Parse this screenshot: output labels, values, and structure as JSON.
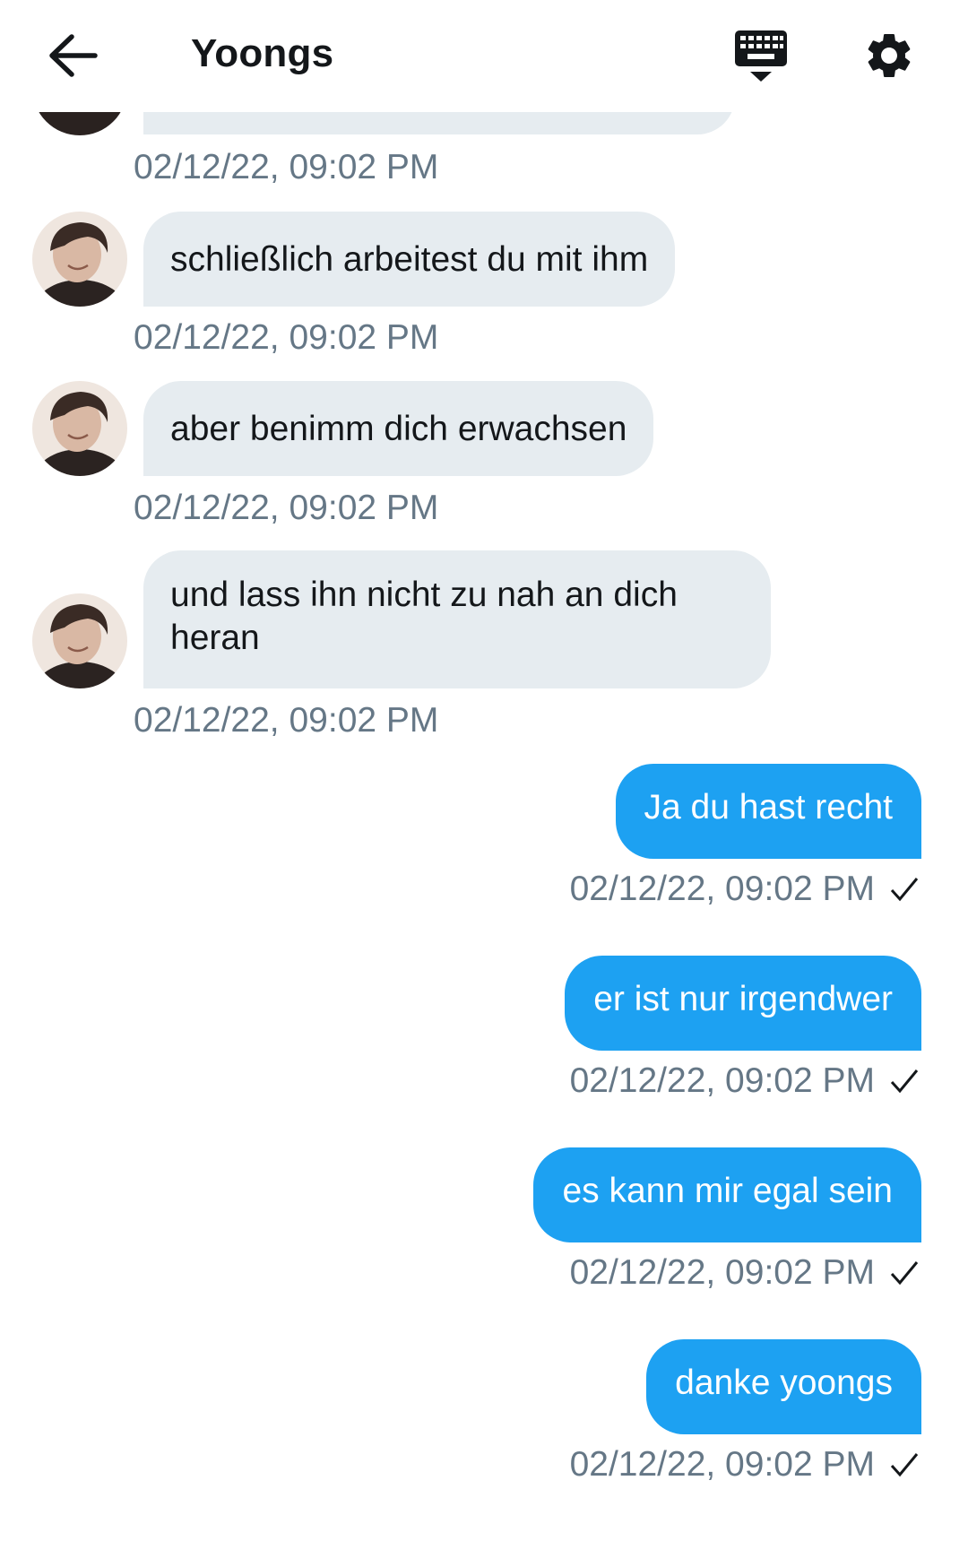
{
  "header": {
    "title": "Yoongs",
    "back_icon": "arrow-left-icon",
    "keyboard_icon": "keyboard-hide-icon",
    "settings_icon": "gear-icon"
  },
  "colors": {
    "incoming_bubble": "#e6ecf0",
    "outgoing_bubble": "#1da1f2",
    "timestamp": "#657786"
  },
  "messages": [
    {
      "direction": "in",
      "text": "schließlich arbeitest du mit ihm",
      "time": "02/12/22, 09:02 PM"
    },
    {
      "direction": "in",
      "text": "aber benimm dich erwachsen",
      "time": "02/12/22, 09:02 PM"
    },
    {
      "direction": "in",
      "text": "und lass ihn nicht zu nah an dich heran",
      "time": "02/12/22, 09:02 PM"
    },
    {
      "direction": "out",
      "text": "Ja du hast recht",
      "time": "02/12/22, 09:02 PM"
    },
    {
      "direction": "out",
      "text": "er ist nur irgendwer",
      "time": "02/12/22, 09:02 PM"
    },
    {
      "direction": "out",
      "text": "es kann mir egal sein",
      "time": "02/12/22, 09:02 PM"
    },
    {
      "direction": "out",
      "text": "danke yoongs",
      "time": "02/12/22, 09:02 PM"
    }
  ],
  "partial_top": {
    "time": "02/12/22, 09:02 PM"
  }
}
